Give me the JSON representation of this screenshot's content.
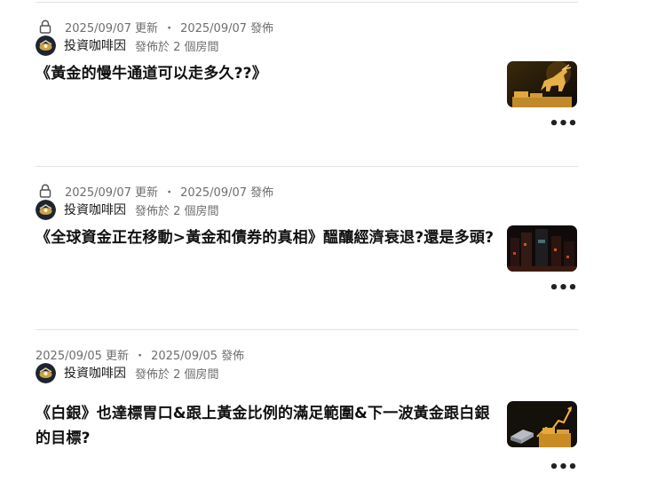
{
  "posts": [
    {
      "locked": true,
      "updated": "2025/09/07 更新",
      "dot": "・",
      "published": "2025/09/07 發佈",
      "author": "投資咖啡因",
      "post_info": "發佈於 2 個房間",
      "title": "《黃金的慢牛通道可以走多久??》",
      "thumbnail_icon": "gold-bull-thumbnail",
      "more": "•••"
    },
    {
      "locked": true,
      "updated": "2025/09/07 更新",
      "dot": "・",
      "published": "2025/09/07 發佈",
      "author": "投資咖啡因",
      "post_info": "發佈於 2 個房間",
      "title": "《全球資金正在移動>黃金和債券的真相》醞釀經濟衰退?還是多頭?",
      "thumbnail_icon": "dark-cityscape-thumbnail",
      "more": "•••"
    },
    {
      "locked": false,
      "updated": "2025/09/05 更新",
      "dot": "・",
      "published": "2025/09/05 發佈",
      "author": "投資咖啡因",
      "post_info": "發佈於 2 個房間",
      "title": "《白銀》也達標胃口&跟上黃金比例的滿足範圍&下一波黃金跟白銀的目標?",
      "thumbnail_icon": "gold-silver-bars-thumbnail",
      "more": "•••"
    }
  ],
  "colors": {
    "meta": "#6e6e6e",
    "divider": "#e2e2e2",
    "gold": "#d9a441"
  }
}
